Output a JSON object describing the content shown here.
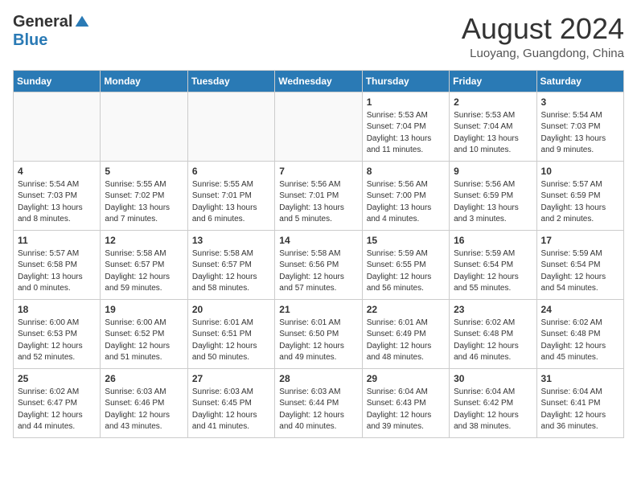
{
  "header": {
    "logo_general": "General",
    "logo_blue": "Blue",
    "month_year": "August 2024",
    "location": "Luoyang, Guangdong, China"
  },
  "weekdays": [
    "Sunday",
    "Monday",
    "Tuesday",
    "Wednesday",
    "Thursday",
    "Friday",
    "Saturday"
  ],
  "weeks": [
    [
      {
        "day": "",
        "info": ""
      },
      {
        "day": "",
        "info": ""
      },
      {
        "day": "",
        "info": ""
      },
      {
        "day": "",
        "info": ""
      },
      {
        "day": "1",
        "info": "Sunrise: 5:53 AM\nSunset: 7:04 PM\nDaylight: 13 hours\nand 11 minutes."
      },
      {
        "day": "2",
        "info": "Sunrise: 5:53 AM\nSunset: 7:04 AM\nDaylight: 13 hours\nand 10 minutes."
      },
      {
        "day": "3",
        "info": "Sunrise: 5:54 AM\nSunset: 7:03 PM\nDaylight: 13 hours\nand 9 minutes."
      }
    ],
    [
      {
        "day": "4",
        "info": "Sunrise: 5:54 AM\nSunset: 7:03 PM\nDaylight: 13 hours\nand 8 minutes."
      },
      {
        "day": "5",
        "info": "Sunrise: 5:55 AM\nSunset: 7:02 PM\nDaylight: 13 hours\nand 7 minutes."
      },
      {
        "day": "6",
        "info": "Sunrise: 5:55 AM\nSunset: 7:01 PM\nDaylight: 13 hours\nand 6 minutes."
      },
      {
        "day": "7",
        "info": "Sunrise: 5:56 AM\nSunset: 7:01 PM\nDaylight: 13 hours\nand 5 minutes."
      },
      {
        "day": "8",
        "info": "Sunrise: 5:56 AM\nSunset: 7:00 PM\nDaylight: 13 hours\nand 4 minutes."
      },
      {
        "day": "9",
        "info": "Sunrise: 5:56 AM\nSunset: 6:59 PM\nDaylight: 13 hours\nand 3 minutes."
      },
      {
        "day": "10",
        "info": "Sunrise: 5:57 AM\nSunset: 6:59 PM\nDaylight: 13 hours\nand 2 minutes."
      }
    ],
    [
      {
        "day": "11",
        "info": "Sunrise: 5:57 AM\nSunset: 6:58 PM\nDaylight: 13 hours\nand 0 minutes."
      },
      {
        "day": "12",
        "info": "Sunrise: 5:58 AM\nSunset: 6:57 PM\nDaylight: 12 hours\nand 59 minutes."
      },
      {
        "day": "13",
        "info": "Sunrise: 5:58 AM\nSunset: 6:57 PM\nDaylight: 12 hours\nand 58 minutes."
      },
      {
        "day": "14",
        "info": "Sunrise: 5:58 AM\nSunset: 6:56 PM\nDaylight: 12 hours\nand 57 minutes."
      },
      {
        "day": "15",
        "info": "Sunrise: 5:59 AM\nSunset: 6:55 PM\nDaylight: 12 hours\nand 56 minutes."
      },
      {
        "day": "16",
        "info": "Sunrise: 5:59 AM\nSunset: 6:54 PM\nDaylight: 12 hours\nand 55 minutes."
      },
      {
        "day": "17",
        "info": "Sunrise: 5:59 AM\nSunset: 6:54 PM\nDaylight: 12 hours\nand 54 minutes."
      }
    ],
    [
      {
        "day": "18",
        "info": "Sunrise: 6:00 AM\nSunset: 6:53 PM\nDaylight: 12 hours\nand 52 minutes."
      },
      {
        "day": "19",
        "info": "Sunrise: 6:00 AM\nSunset: 6:52 PM\nDaylight: 12 hours\nand 51 minutes."
      },
      {
        "day": "20",
        "info": "Sunrise: 6:01 AM\nSunset: 6:51 PM\nDaylight: 12 hours\nand 50 minutes."
      },
      {
        "day": "21",
        "info": "Sunrise: 6:01 AM\nSunset: 6:50 PM\nDaylight: 12 hours\nand 49 minutes."
      },
      {
        "day": "22",
        "info": "Sunrise: 6:01 AM\nSunset: 6:49 PM\nDaylight: 12 hours\nand 48 minutes."
      },
      {
        "day": "23",
        "info": "Sunrise: 6:02 AM\nSunset: 6:48 PM\nDaylight: 12 hours\nand 46 minutes."
      },
      {
        "day": "24",
        "info": "Sunrise: 6:02 AM\nSunset: 6:48 PM\nDaylight: 12 hours\nand 45 minutes."
      }
    ],
    [
      {
        "day": "25",
        "info": "Sunrise: 6:02 AM\nSunset: 6:47 PM\nDaylight: 12 hours\nand 44 minutes."
      },
      {
        "day": "26",
        "info": "Sunrise: 6:03 AM\nSunset: 6:46 PM\nDaylight: 12 hours\nand 43 minutes."
      },
      {
        "day": "27",
        "info": "Sunrise: 6:03 AM\nSunset: 6:45 PM\nDaylight: 12 hours\nand 41 minutes."
      },
      {
        "day": "28",
        "info": "Sunrise: 6:03 AM\nSunset: 6:44 PM\nDaylight: 12 hours\nand 40 minutes."
      },
      {
        "day": "29",
        "info": "Sunrise: 6:04 AM\nSunset: 6:43 PM\nDaylight: 12 hours\nand 39 minutes."
      },
      {
        "day": "30",
        "info": "Sunrise: 6:04 AM\nSunset: 6:42 PM\nDaylight: 12 hours\nand 38 minutes."
      },
      {
        "day": "31",
        "info": "Sunrise: 6:04 AM\nSunset: 6:41 PM\nDaylight: 12 hours\nand 36 minutes."
      }
    ]
  ]
}
